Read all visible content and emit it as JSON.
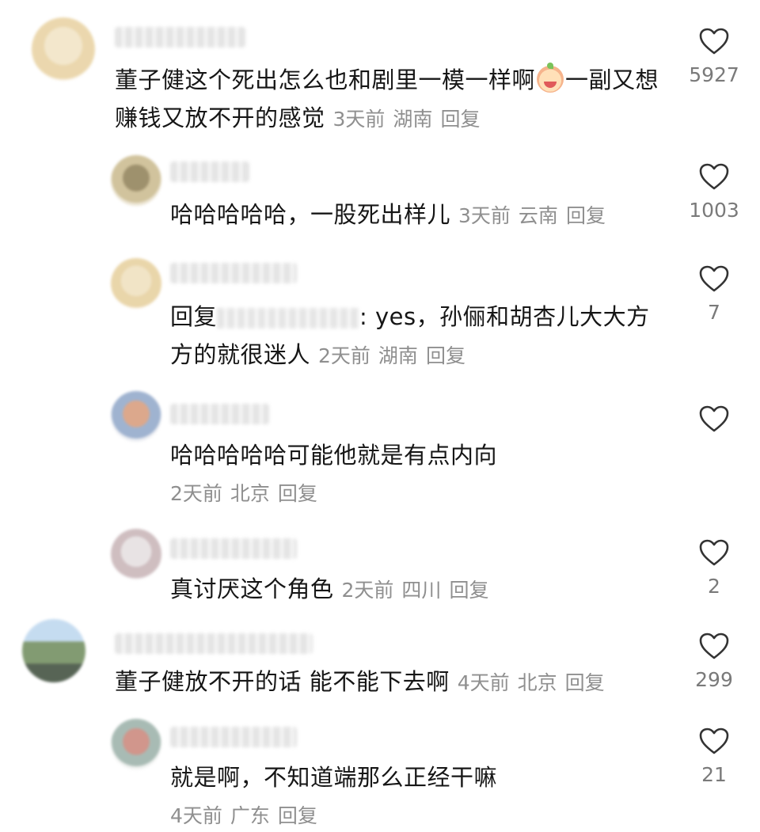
{
  "comments": [
    {
      "text": "董子健这个死出怎么也和剧里一模一样啊",
      "text_after": "一副又想赚钱又放不开的感觉",
      "emoji": "crying-laughing-emoji",
      "time": "3天前",
      "location": "湖南",
      "reply": "回复",
      "likes": "5927"
    },
    {
      "text": "哈哈哈哈哈，一股死出样儿",
      "time": "3天前",
      "location": "云南",
      "reply": "回复",
      "likes": "1003"
    },
    {
      "text_prefix": "回复",
      "text": ": yes，孙俪和胡杏儿大大方方的就很迷人",
      "time": "2天前",
      "location": "湖南",
      "reply": "回复",
      "likes": "7"
    },
    {
      "text": "哈哈哈哈哈可能他就是有点内向",
      "time": "2天前",
      "location": "北京",
      "reply": "回复",
      "likes": ""
    },
    {
      "text": "真讨厌这个角色",
      "time": "2天前",
      "location": "四川",
      "reply": "回复",
      "likes": "2"
    },
    {
      "text": "董子健放不开的话 能不能下去啊",
      "time": "4天前",
      "location": "北京",
      "reply": "回复",
      "likes": "299"
    },
    {
      "text": "就是啊，不知道端那么正经干嘛",
      "time": "4天前",
      "location": "广东",
      "reply": "回复",
      "likes": "21"
    }
  ],
  "icons": {
    "like": "heart-outline-icon"
  },
  "colors": {
    "text": "#161616",
    "meta": "#8f8f8f",
    "icon": "#333333"
  }
}
